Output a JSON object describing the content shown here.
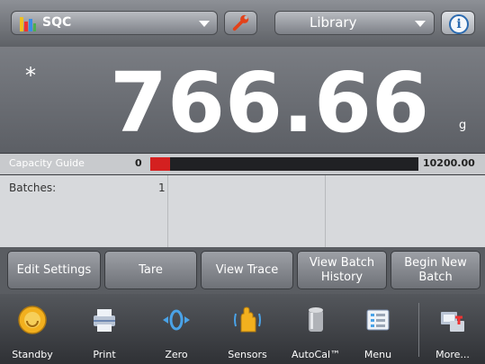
{
  "header": {
    "app_name": "SQC",
    "library_label": "Library",
    "info_symbol": "i",
    "icons": [
      "bar-chart-icon",
      "wrench-icon",
      "info-icon"
    ]
  },
  "display": {
    "stable_marker": "*",
    "weight": "766.66",
    "unit": "g"
  },
  "capacity": {
    "label": "Capacity Guide",
    "min": "0",
    "max": "10200.00",
    "fill_fraction": 0.075,
    "fill_color": "#d42020"
  },
  "batches": {
    "label": "Batches:",
    "value": "1"
  },
  "actions": [
    {
      "label": "Edit Settings"
    },
    {
      "label": "Tare"
    },
    {
      "label": "View Trace"
    },
    {
      "label": "View Batch History"
    },
    {
      "label": "Begin New Batch"
    }
  ],
  "bottom_nav": [
    {
      "label": "Standby",
      "icon": "standby-icon"
    },
    {
      "label": "Print",
      "icon": "print-icon"
    },
    {
      "label": "Zero",
      "icon": "zero-icon"
    },
    {
      "label": "Sensors",
      "icon": "sensors-icon"
    },
    {
      "label": "AutoCal™",
      "icon": "autocal-icon"
    },
    {
      "label": "Menu",
      "icon": "menu-icon"
    },
    {
      "label": "More...",
      "icon": "more-icon"
    }
  ]
}
